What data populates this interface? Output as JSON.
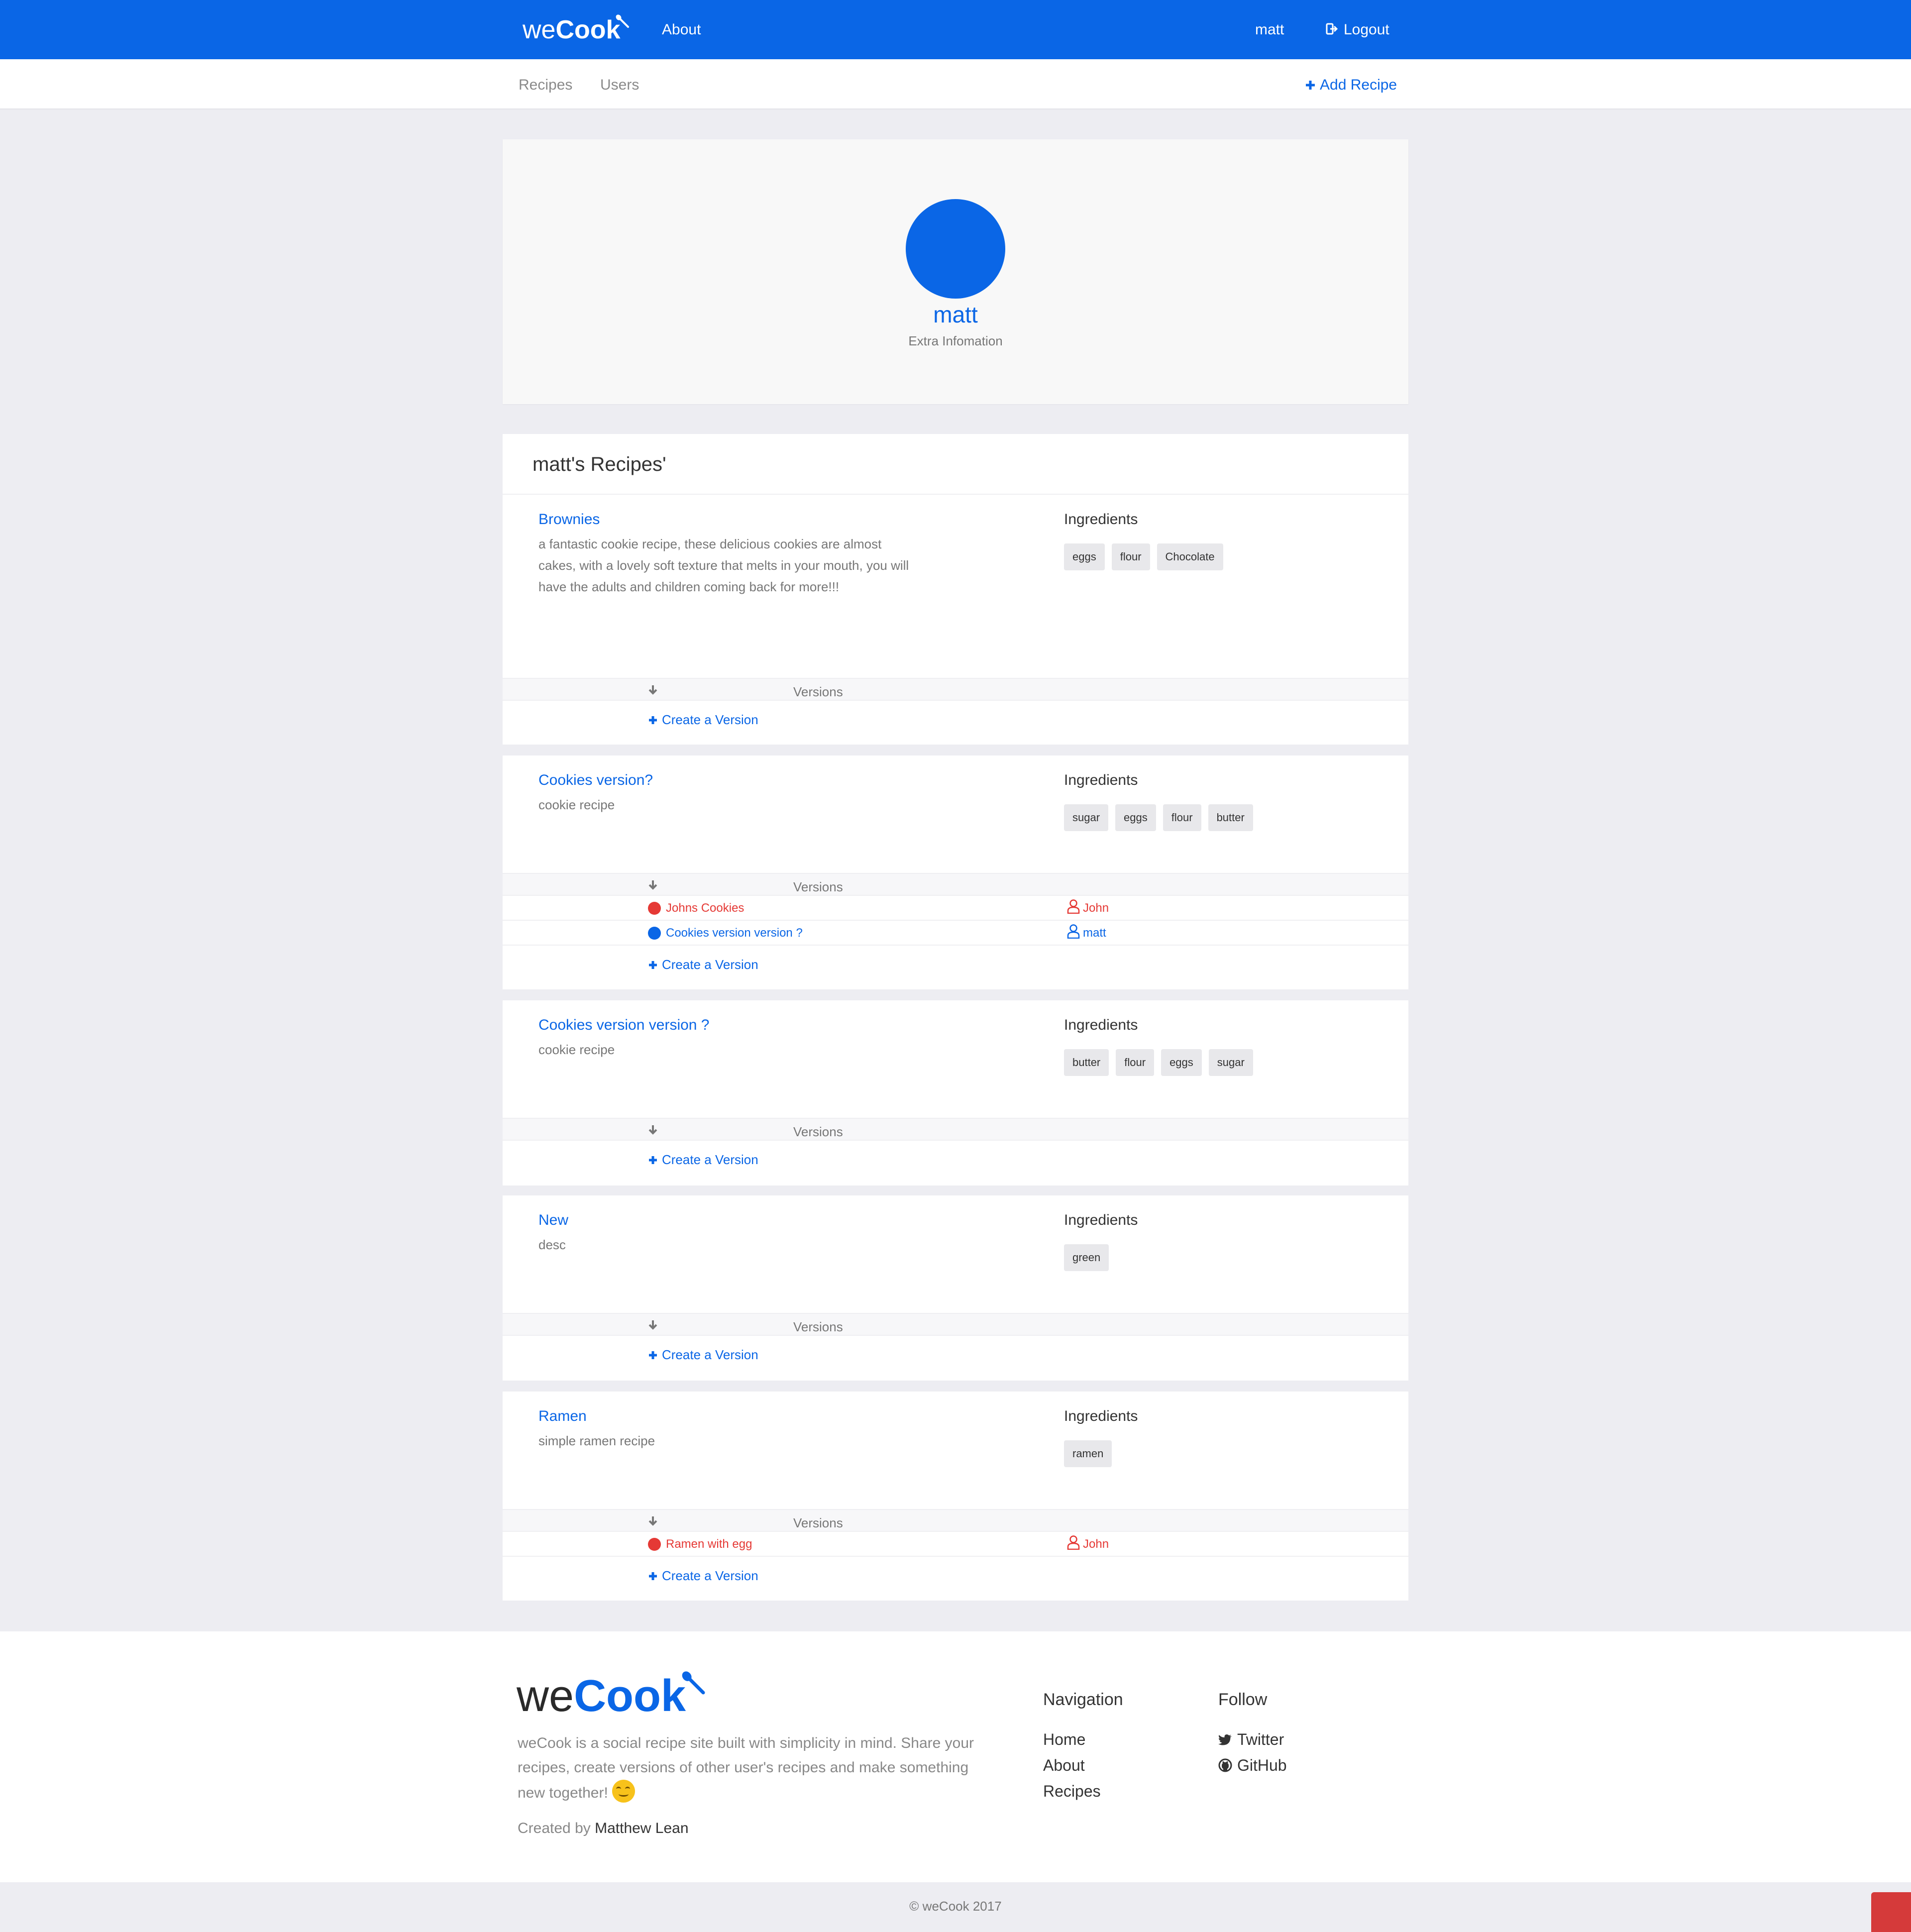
{
  "header": {
    "logo_light": "we",
    "logo_bold": "Cook",
    "about": "About",
    "user": "matt",
    "logout": "Logout"
  },
  "subnav": {
    "recipes": "Recipes",
    "users": "Users",
    "add_recipe": "Add Recipe"
  },
  "profile": {
    "name": "matt",
    "info": "Extra Infomation",
    "avatar_color": "#0a66e6"
  },
  "recipes_heading": "matt's Recipes'",
  "labels": {
    "ingredients": "Ingredients",
    "versions": "Versions",
    "create_version": "Create a Version"
  },
  "recipes": [
    {
      "title": "Brownies",
      "description": "a fantastic cookie recipe, these delicious cookies are almost cakes, with a lovely soft texture that melts in your mouth, you will have the adults and children coming back for more!!!",
      "ingredients": [
        "eggs",
        "flour",
        "Chocolate"
      ],
      "versions": []
    },
    {
      "title": "Cookies version?",
      "description": "cookie recipe",
      "ingredients": [
        "sugar",
        "eggs",
        "flour",
        "butter"
      ],
      "versions": [
        {
          "name": "Johns Cookies",
          "user": "John",
          "color": "red"
        },
        {
          "name": "Cookies version version ?",
          "user": "matt",
          "color": "blue"
        }
      ]
    },
    {
      "title": "Cookies version version ?",
      "description": "cookie recipe",
      "ingredients": [
        "butter",
        "flour",
        "eggs",
        "sugar"
      ],
      "versions": []
    },
    {
      "title": "New",
      "description": "desc",
      "ingredients": [
        "green"
      ],
      "versions": []
    },
    {
      "title": "Ramen",
      "description": "simple ramen recipe",
      "ingredients": [
        "ramen"
      ],
      "versions": [
        {
          "name": "Ramen with egg",
          "user": "John",
          "color": "red"
        }
      ]
    }
  ],
  "footer": {
    "logo_light": "we",
    "logo_bold": "Cook",
    "about_text": "weCook is a social recipe site built with simplicity in mind. Share your recipes, create versions of other user's recipes and make something new together!",
    "emoji_icon": "smiling-face-icon",
    "created_by_label": "Created by",
    "author": "Matthew Lean",
    "navigation": {
      "heading": "Navigation",
      "links": [
        "Home",
        "About",
        "Recipes"
      ]
    },
    "follow": {
      "heading": "Follow",
      "links": [
        "Twitter",
        "GitHub"
      ]
    },
    "copyright": "© weCook 2017"
  },
  "colors": {
    "brand": "#0a66e6",
    "danger": "#e53935"
  }
}
